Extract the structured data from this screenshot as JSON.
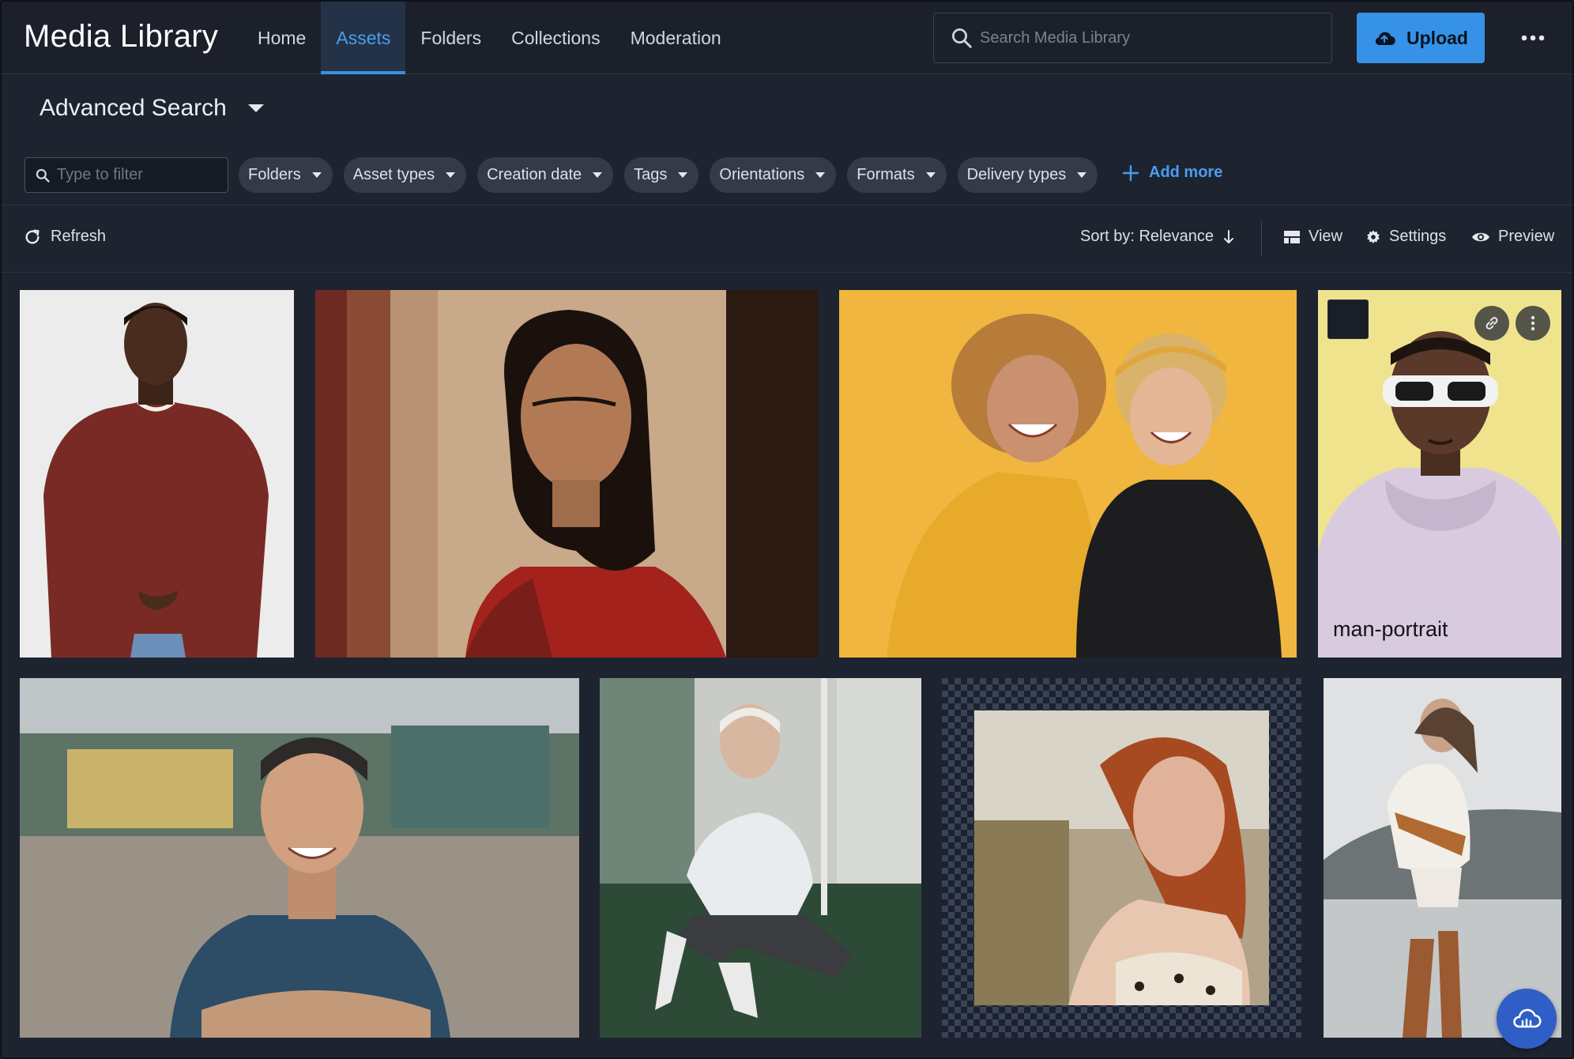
{
  "app": {
    "title": "Media Library"
  },
  "nav": {
    "items": [
      {
        "label": "Home"
      },
      {
        "label": "Assets",
        "active": true
      },
      {
        "label": "Folders"
      },
      {
        "label": "Collections"
      },
      {
        "label": "Moderation"
      }
    ]
  },
  "search": {
    "placeholder": "Search Media Library"
  },
  "upload": {
    "label": "Upload"
  },
  "advanced_search": {
    "label": "Advanced Search"
  },
  "filters": {
    "placeholder": "Type to filter",
    "chips": [
      {
        "label": "Folders"
      },
      {
        "label": "Asset types"
      },
      {
        "label": "Creation date"
      },
      {
        "label": "Tags"
      },
      {
        "label": "Orientations"
      },
      {
        "label": "Formats"
      },
      {
        "label": "Delivery types"
      }
    ],
    "add_more": "Add more"
  },
  "toolbar": {
    "refresh": "Refresh",
    "sort": "Sort by: Relevance",
    "view": "View",
    "settings": "Settings",
    "preview": "Preview"
  },
  "assets": [
    {
      "label": "",
      "hovered": false
    },
    {
      "label": "",
      "hovered": false
    },
    {
      "label": "",
      "hovered": false
    },
    {
      "label": "man-portrait",
      "hovered": true
    },
    {
      "label": "",
      "hovered": false
    },
    {
      "label": "",
      "hovered": false
    },
    {
      "label": "",
      "hovered": false
    },
    {
      "label": "",
      "hovered": false
    }
  ],
  "colors": {
    "accent": "#3592e6",
    "background": "#1e2330",
    "topbar": "#1b202b",
    "chip": "#343a48"
  }
}
